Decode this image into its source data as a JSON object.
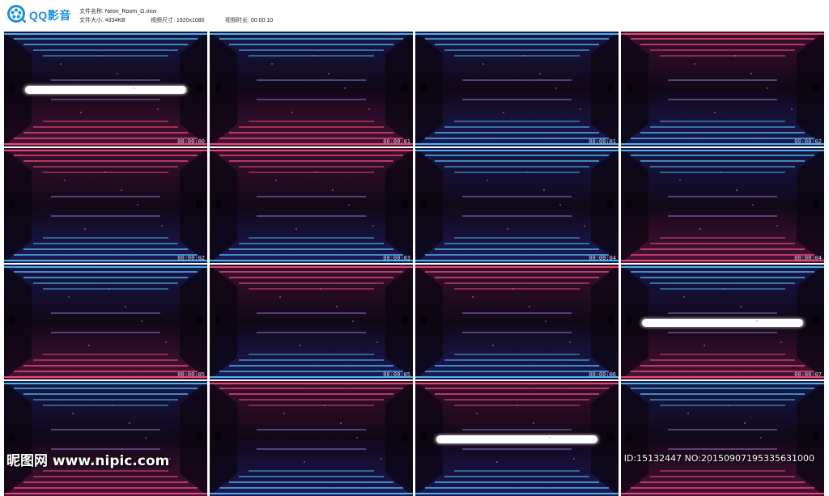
{
  "app": {
    "name": "QQ影音",
    "icon": "film-reel-icon",
    "brand_color": "#1a8fd8"
  },
  "file_info": {
    "name_label": "文件名称:",
    "name_value": "Neon_Room_G.mov",
    "size_label": "文件大小:",
    "size_value": "4334KB",
    "dim_label": "视频尺寸:",
    "dim_value": "1920x1080",
    "duration_label": "视频时长:",
    "duration_value": "00:00:10"
  },
  "thumbnails": [
    {
      "timestamp": "00:00:00",
      "top": "blue",
      "bottom": "red",
      "white_bar": true
    },
    {
      "timestamp": "00:00:01",
      "top": "blue",
      "bottom": "red",
      "white_bar": false
    },
    {
      "timestamp": "00:00:01",
      "top": "blue",
      "bottom": "blue",
      "white_bar": false
    },
    {
      "timestamp": "00:00:02",
      "top": "red",
      "bottom": "blue",
      "white_bar": false
    },
    {
      "timestamp": "00:00:02",
      "top": "red",
      "bottom": "blue",
      "white_bar": false
    },
    {
      "timestamp": "00:00:03",
      "top": "red",
      "bottom": "blue",
      "white_bar": false
    },
    {
      "timestamp": "00:00:04",
      "top": "blue",
      "bottom": "blue",
      "white_bar": false
    },
    {
      "timestamp": "00:00:04",
      "top": "blue",
      "bottom": "red",
      "white_bar": false
    },
    {
      "timestamp": "00:00:05",
      "top": "blue",
      "bottom": "red",
      "white_bar": false
    },
    {
      "timestamp": "00:00:05",
      "top": "red",
      "bottom": "blue",
      "white_bar": false
    },
    {
      "timestamp": "00:00:06",
      "top": "red",
      "bottom": "blue",
      "white_bar": false
    },
    {
      "timestamp": "00:00:07",
      "top": "blue",
      "bottom": "red",
      "white_bar": true
    },
    {
      "timestamp": "",
      "top": "blue",
      "bottom": "red",
      "white_bar": false
    },
    {
      "timestamp": "",
      "top": "red",
      "bottom": "blue",
      "white_bar": false
    },
    {
      "timestamp": "",
      "top": "red",
      "bottom": "blue",
      "white_bar": true
    },
    {
      "timestamp": "",
      "top": "blue",
      "bottom": "red",
      "white_bar": false
    }
  ],
  "colors": {
    "neon_blue": "#3fc3ff",
    "neon_red": "#ff3a6e",
    "room_dark": "#1a0a22"
  },
  "watermark": {
    "text": "昵图网 www.nipic.com",
    "id_text": "ID:15132447 NO:20150907195335631000"
  }
}
